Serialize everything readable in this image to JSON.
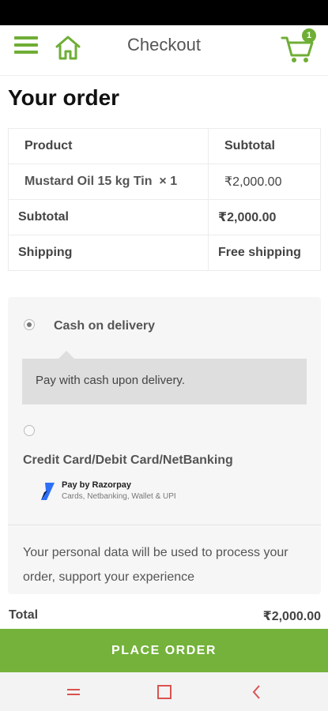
{
  "header": {
    "title": "Checkout",
    "cart_count": "1"
  },
  "order": {
    "heading": "Your order",
    "columns": [
      "Product",
      "Subtotal"
    ],
    "items": [
      {
        "product": "Mustard Oil 15 kg Tin",
        "qty": "× 1",
        "subtotal": "₹2,000.00"
      }
    ],
    "subtotal_label": "Subtotal",
    "subtotal_value": "₹2,000.00",
    "shipping_label": "Shipping",
    "shipping_value": "Free shipping"
  },
  "payment": {
    "methods": [
      {
        "label": "Cash on delivery",
        "selected": true,
        "description": "Pay with cash upon delivery."
      },
      {
        "label": "Credit Card/Debit Card/NetBanking",
        "selected": false
      }
    ],
    "razorpay_title": "Pay by Razorpay",
    "razorpay_sub": "Cards, Netbanking, Wallet & UPI",
    "privacy_text": "Your personal data will be used to process your order, support your experience"
  },
  "total": {
    "label": "Total",
    "value": "₹2,000.00"
  },
  "place_order_label": "PLACE ORDER",
  "colors": {
    "accent": "#74b23b",
    "icon_green": "#6fae36",
    "nav_red": "#d9534f"
  }
}
